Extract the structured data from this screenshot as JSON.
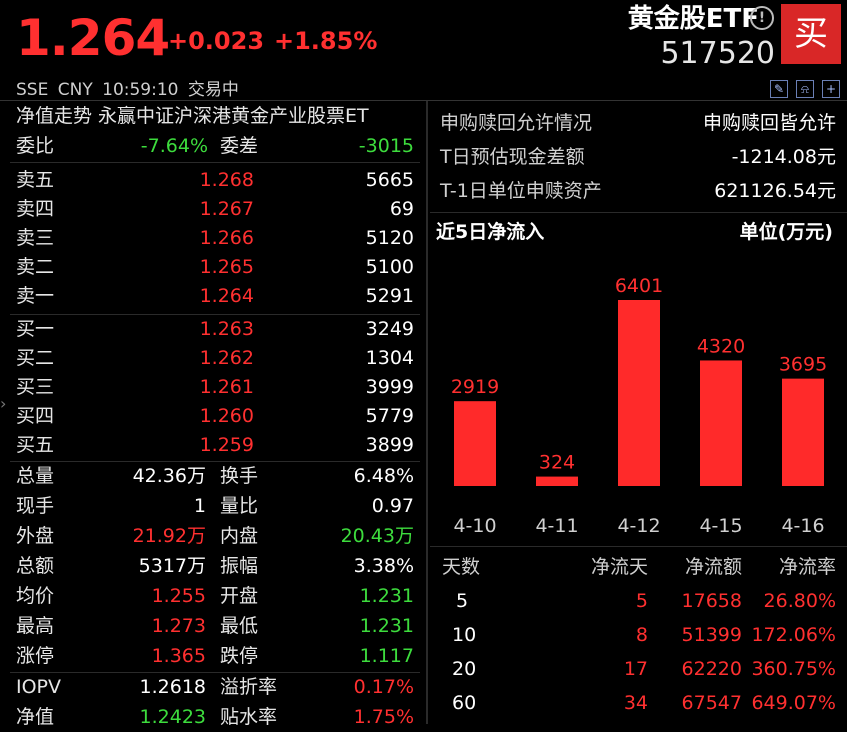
{
  "header": {
    "price": "1.264",
    "change": "+0.023",
    "change_pct": "+1.85%",
    "name": "黄金股ETF",
    "code": "517520",
    "info_icon": "!",
    "buy_label": "买",
    "exchange": "SSE",
    "currency": "CNY",
    "time": "10:59:10",
    "status": "交易中"
  },
  "left": {
    "title": "净值走势 永赢中证沪深港黄金产业股票ET",
    "weibi_label": "委比",
    "weibi": "-7.64%",
    "weicha_label": "委差",
    "weicha": "-3015",
    "sells": [
      {
        "label": "卖五",
        "price": "1.268",
        "vol": "5665"
      },
      {
        "label": "卖四",
        "price": "1.267",
        "vol": "69"
      },
      {
        "label": "卖三",
        "price": "1.266",
        "vol": "5120"
      },
      {
        "label": "卖二",
        "price": "1.265",
        "vol": "5100"
      },
      {
        "label": "卖一",
        "price": "1.264",
        "vol": "5291"
      }
    ],
    "buys": [
      {
        "label": "买一",
        "price": "1.263",
        "vol": "3249"
      },
      {
        "label": "买二",
        "price": "1.262",
        "vol": "1304"
      },
      {
        "label": "买三",
        "price": "1.261",
        "vol": "3999"
      },
      {
        "label": "买四",
        "price": "1.260",
        "vol": "5779"
      },
      {
        "label": "买五",
        "price": "1.259",
        "vol": "3899"
      }
    ],
    "stats": [
      {
        "l1": "总量",
        "v1": "42.36万",
        "l2": "换手",
        "v2": "6.48%"
      },
      {
        "l1": "现手",
        "v1": "1",
        "l2": "量比",
        "v2": "0.97"
      },
      {
        "l1": "外盘",
        "v1": "21.92万",
        "l2": "内盘",
        "v2": "20.43万"
      },
      {
        "l1": "总额",
        "v1": "5317万",
        "l2": "振幅",
        "v2": "3.38%"
      },
      {
        "l1": "均价",
        "v1": "1.255",
        "l2": "开盘",
        "v2": "1.231"
      },
      {
        "l1": "最高",
        "v1": "1.273",
        "l2": "最低",
        "v2": "1.231"
      },
      {
        "l1": "涨停",
        "v1": "1.365",
        "l2": "跌停",
        "v2": "1.117"
      },
      {
        "l1": "IOPV",
        "v1": "1.2618",
        "l2": "溢折率",
        "v2": "0.17%"
      },
      {
        "l1": "净值",
        "v1": "1.2423",
        "l2": "贴水率",
        "v2": "1.75%"
      }
    ]
  },
  "right": {
    "info": [
      {
        "k": "申购赎回允许情况",
        "v": "申购赎回皆允许"
      },
      {
        "k": "T日预估现金差额",
        "v": "-1214.08元"
      },
      {
        "k": "T-1日单位申赎资产",
        "v": "621126.54元"
      }
    ],
    "flow_title": "近5日净流入",
    "flow_unit": "单位(万元)",
    "table_headers": [
      "天数",
      "净流天",
      "净流额",
      "净流率"
    ],
    "table_rows": [
      [
        "5",
        "5",
        "17658",
        "26.80%"
      ],
      [
        "10",
        "8",
        "51399",
        "172.06%"
      ],
      [
        "20",
        "17",
        "62220",
        "360.75%"
      ],
      [
        "60",
        "34",
        "67547",
        "649.07%"
      ]
    ]
  },
  "colors": {
    "up": "#ff3030",
    "down": "#3ddc3d",
    "bar": "#ff2a2a",
    "buy_button": "#d92727"
  },
  "chart_data": {
    "type": "bar",
    "categories": [
      "4-10",
      "4-11",
      "4-12",
      "4-15",
      "4-16"
    ],
    "values": [
      2919,
      324,
      6401,
      4320,
      3695
    ],
    "title": "近5日净流入",
    "ylabel": "单位(万元)",
    "ylim": [
      0,
      6401
    ]
  }
}
